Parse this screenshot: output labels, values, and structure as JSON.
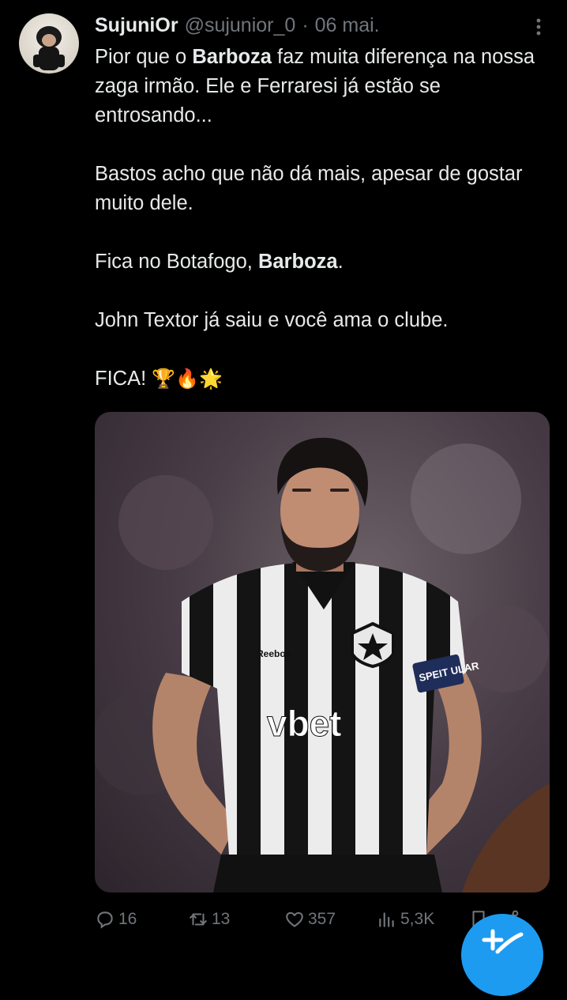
{
  "tweet": {
    "author": {
      "name": "SujuniOr",
      "handle": "@sujunior_0",
      "separator": "·",
      "date": "06 mai."
    },
    "paragraphs": {
      "p1": {
        "a": "Pior que o ",
        "b1": "Barboza",
        "c": " faz muita diferença na nossa zaga irmão. Ele e Ferraresi já estão se entrosando..."
      },
      "p2": "Bastos acho que não dá mais, apesar de gostar muito dele.",
      "p3": {
        "a": "Fica no Botafogo, ",
        "b1": "Barboza",
        "c": "."
      },
      "p4": "John Textor já saiu e você ama o clube.",
      "p5": {
        "a": "FICA! ",
        "emojis": "🏆🔥🌟"
      }
    },
    "media": {
      "kit_brand": "vbet",
      "kit_maker": "Reebok",
      "armband": "SPEIT ULAR"
    },
    "actions": {
      "replies": "16",
      "reposts": "13",
      "likes": "357",
      "views": "5,3K"
    }
  },
  "colors": {
    "background": "#000000",
    "text": "#e7e9ea",
    "muted": "#71767b",
    "accent": "#1d9bf0"
  },
  "icons": [
    "more-icon",
    "reply-icon",
    "repost-icon",
    "like-icon",
    "views-icon",
    "bookmark-icon",
    "share-icon",
    "compose-icon"
  ]
}
